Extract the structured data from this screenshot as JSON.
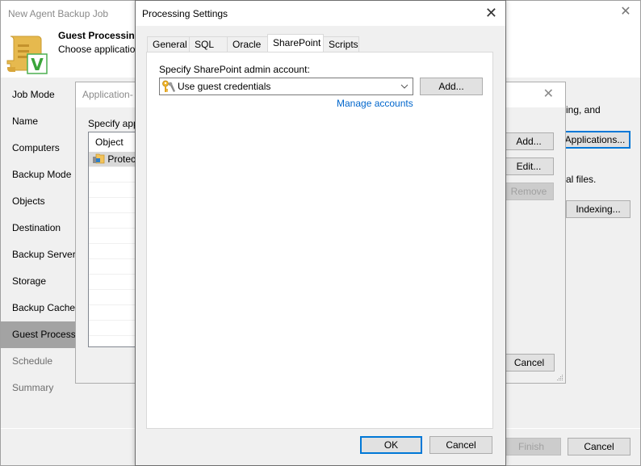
{
  "main_window": {
    "title": "New Agent Backup Job",
    "header_title": "Guest Processing",
    "header_subtitle": "Choose application",
    "steps": [
      {
        "label": "Job Mode",
        "state": "normal"
      },
      {
        "label": "Name",
        "state": "normal"
      },
      {
        "label": "Computers",
        "state": "normal"
      },
      {
        "label": "Backup Mode",
        "state": "normal"
      },
      {
        "label": "Objects",
        "state": "normal"
      },
      {
        "label": "Destination",
        "state": "normal"
      },
      {
        "label": "Backup Server",
        "state": "normal"
      },
      {
        "label": "Storage",
        "state": "normal"
      },
      {
        "label": "Backup Cache",
        "state": "normal"
      },
      {
        "label": "Guest Processing",
        "state": "active"
      },
      {
        "label": "Schedule",
        "state": "disabled"
      },
      {
        "label": "Summary",
        "state": "disabled"
      }
    ],
    "right_text1": "ing, and",
    "right_text2": "al files.",
    "applications_button": "Applications...",
    "indexing_button": "Indexing...",
    "finish_button": "Finish",
    "cancel_button": "Cancel"
  },
  "app_dialog": {
    "title": "Application-",
    "label": "Specify app",
    "list_header": "Object",
    "rows": [
      "Protec"
    ],
    "add_button": "Add...",
    "edit_button": "Edit...",
    "remove_button": "Remove",
    "cancel_button": "Cancel"
  },
  "processing_settings": {
    "title": "Processing Settings",
    "tabs": [
      {
        "label": "General",
        "active": false
      },
      {
        "label": "SQL",
        "active": false
      },
      {
        "label": "Oracle",
        "active": false
      },
      {
        "label": "SharePoint",
        "active": true
      },
      {
        "label": "Scripts",
        "active": false
      }
    ],
    "sharepoint": {
      "account_label": "Specify SharePoint admin account:",
      "account_value": "Use guest credentials",
      "add_button": "Add...",
      "manage_link": "Manage accounts"
    },
    "ok_button": "OK",
    "cancel_button": "Cancel"
  },
  "colors": {
    "accent": "#0078d7",
    "link": "#0066cc",
    "active_step": "#a3a3a3"
  }
}
